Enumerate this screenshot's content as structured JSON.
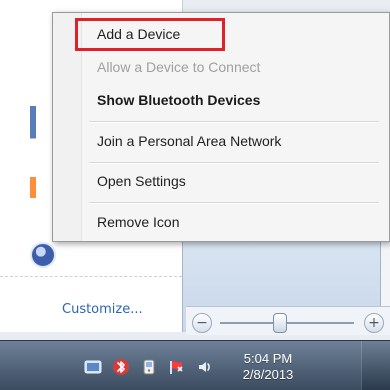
{
  "context_menu": {
    "items": [
      {
        "label": "Add a Device",
        "state": "normal"
      },
      {
        "label": "Allow a Device to Connect",
        "state": "disabled"
      },
      {
        "label": "Show Bluetooth Devices",
        "state": "bold"
      },
      {
        "label": "Join a Personal Area Network",
        "state": "normal"
      },
      {
        "label": "Open Settings",
        "state": "normal"
      },
      {
        "label": "Remove Icon",
        "state": "normal"
      }
    ],
    "highlight_color": "#e0202a"
  },
  "background": {
    "customize_link": "Customize..."
  },
  "zoom_slider": {
    "minus_label": "−",
    "plus_label": "+",
    "value_fraction": 0.45
  },
  "taskbar": {
    "clock": {
      "time": "5:04 PM",
      "date": "2/8/2013"
    },
    "tray_icons": [
      "network-icon",
      "bluetooth-icon",
      "device-icon",
      "flag-icon",
      "volume-icon"
    ]
  }
}
